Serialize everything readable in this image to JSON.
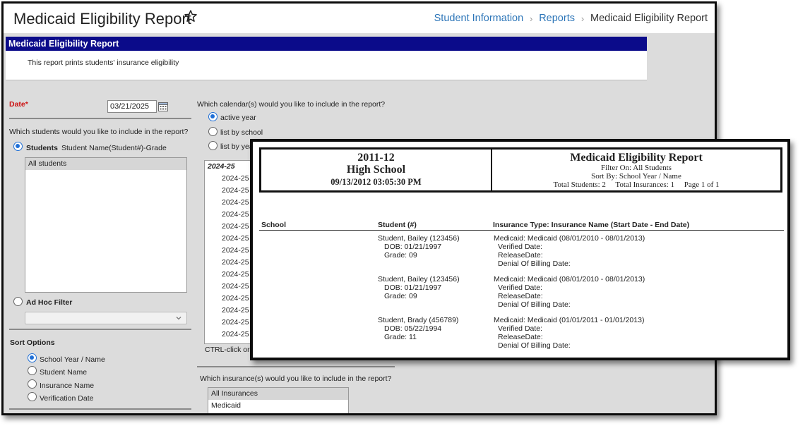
{
  "header": {
    "title": "Medicaid Eligibility Report",
    "breadcrumb": [
      "Student Information",
      "Reports",
      "Medicaid Eligibility Report"
    ]
  },
  "report_header": {
    "bar_title": "Medicaid Eligibility Report",
    "description": "This report prints students' insurance eligibility"
  },
  "form": {
    "date_label": "Date*",
    "date_value": "03/21/2025",
    "students_question": "Which students would you like to include in the report?",
    "students_radio_label": "Students",
    "students_format": "Student Name(Student#)-Grade",
    "students_options": [
      "All students"
    ],
    "adhoc_label": "Ad Hoc Filter",
    "sort_options_label": "Sort Options",
    "sort_options": [
      "School Year / Name",
      "Student Name",
      "Insurance Name",
      "Verification Date"
    ],
    "calendar_question": "Which calendar(s) would you like to include in the report?",
    "calendar_options": [
      "active year",
      "list by school",
      "list by year"
    ],
    "calendar_list_header": "2024-25",
    "calendar_list_items": [
      "2024-25",
      "2024-25",
      "2024-25",
      "2024-25",
      "2024-25",
      "2024-25",
      "2024-25",
      "2024-25",
      "2024-25",
      "2024-25",
      "2024-25",
      "2024-25",
      "2024-25",
      "2024-25"
    ],
    "ctrl_hint": "CTRL-click or",
    "insurance_question": "Which insurance(s) would you like to include in the report?",
    "insurance_options": [
      "All Insurances",
      "Medicaid"
    ]
  },
  "preview": {
    "school_year": "2011-12",
    "school": "High School",
    "generated": "09/13/2012 03:05:30 PM",
    "title": "Medicaid Eligibility Report",
    "filter": "Filter On: All Students",
    "sort": "Sort By: School Year / Name",
    "totals": "Total Students: 2     Total Insurances: 1     Page 1 of 1",
    "columns": [
      "School",
      "Student (#)",
      "Insurance Type: Insurance Name (Start Date - End Date)"
    ],
    "rows": [
      {
        "student": "Student, Bailey (123456)",
        "dob": "DOB: 01/21/1997",
        "grade": "Grade: 09",
        "insurance": "Medicaid: Medicaid (08/01/2010 - 08/01/2013)",
        "verified": "Verified Date:",
        "release": "ReleaseDate:",
        "denial": "Denial Of Billing Date:"
      },
      {
        "student": "Student, Bailey (123456)",
        "dob": "DOB: 01/21/1997",
        "grade": "Grade: 09",
        "insurance": "Medicaid: Medicaid (08/01/2010 - 08/01/2013)",
        "verified": "Verified Date:",
        "release": "ReleaseDate:",
        "denial": "Denial Of Billing Date:"
      },
      {
        "student": "Student, Brady (456789)",
        "dob": "DOB: 05/22/1994",
        "grade": "Grade: 11",
        "insurance": "Medicaid: Medicaid (01/01/2011 - 01/01/2013)",
        "verified": "Verified Date:",
        "release": "ReleaseDate:",
        "denial": "Denial Of Billing Date:"
      }
    ]
  },
  "colors": {
    "accent_link": "#2c75b8",
    "report_bar": "#0b0b8a",
    "required": "#cc1111",
    "radio": "#1f6fd6"
  },
  "icons": [
    "star-icon",
    "chevron-right-icon",
    "calendar-icon",
    "chevron-down-icon"
  ]
}
